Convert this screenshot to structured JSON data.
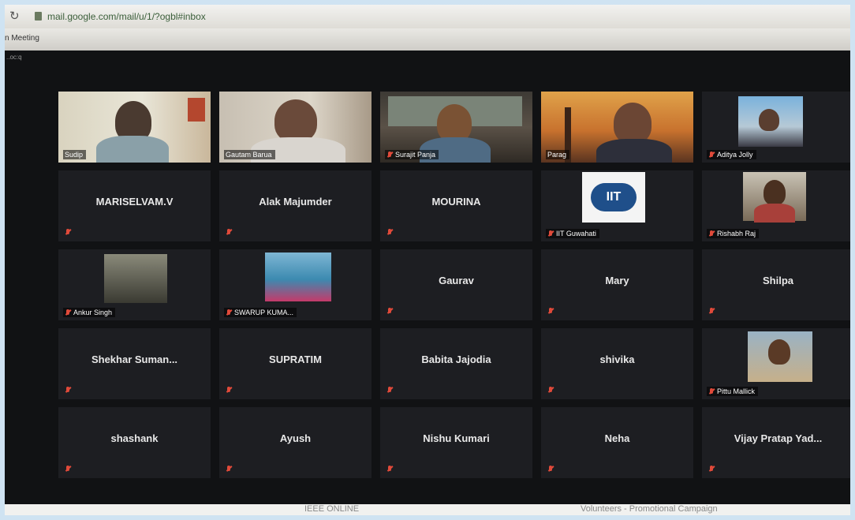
{
  "browser": {
    "url": "mail.google.com/mail/u/1/?ogbl#inbox",
    "tab_title": "n Meeting"
  },
  "window": {
    "title": "..oc:q"
  },
  "participants": [
    {
      "name": "Sudip",
      "video": true,
      "active": true,
      "muted": false
    },
    {
      "name": "Gautam Barua",
      "video": true,
      "muted": false
    },
    {
      "name": "Surajit Panja",
      "video": true,
      "muted": true
    },
    {
      "name": "Parag",
      "video": true,
      "muted": false
    },
    {
      "name": "Aditya Jolly",
      "video": "thumb",
      "muted": true
    },
    {
      "name": "MARISELVAM.V",
      "video": false,
      "muted": true
    },
    {
      "name": "Alak Majumder",
      "video": false,
      "muted": true
    },
    {
      "name": "MOURINA",
      "video": false,
      "muted": true
    },
    {
      "name": "IIT Guwahati",
      "video": "logo",
      "muted": true
    },
    {
      "name": "Rishabh Raj",
      "video": "thumb",
      "muted": true
    },
    {
      "name": "Ankur Singh",
      "video": "thumb",
      "muted": true
    },
    {
      "name": "SWARUP KUMA...",
      "video": "thumb",
      "muted": true
    },
    {
      "name": "Gaurav",
      "video": false,
      "muted": true
    },
    {
      "name": "Mary",
      "video": false,
      "muted": true
    },
    {
      "name": "Shilpa",
      "video": false,
      "muted": true
    },
    {
      "name": "Shekhar Suman...",
      "video": false,
      "muted": true
    },
    {
      "name": "SUPRATIM",
      "video": false,
      "muted": true
    },
    {
      "name": "Babita Jajodia",
      "video": false,
      "muted": true
    },
    {
      "name": "shivika",
      "video": false,
      "muted": true
    },
    {
      "name": "Pittu Mallick",
      "video": "thumb",
      "muted": true
    },
    {
      "name": "shashank",
      "video": false,
      "muted": true
    },
    {
      "name": "Ayush",
      "video": false,
      "muted": true
    },
    {
      "name": "Nishu Kumari",
      "video": false,
      "muted": true
    },
    {
      "name": "Neha",
      "video": false,
      "muted": true
    },
    {
      "name": "Vijay Pratap Yad...",
      "video": false,
      "muted": true
    }
  ],
  "logo_text": "IIT",
  "bottom": {
    "left_text": "IEEE ONLINE",
    "right_text": "Volunteers - Promotional Campaign"
  },
  "colors": {
    "active_border": "#d6e85a",
    "muted_icon": "#e04a3a",
    "tile_bg": "#1d1e22"
  }
}
